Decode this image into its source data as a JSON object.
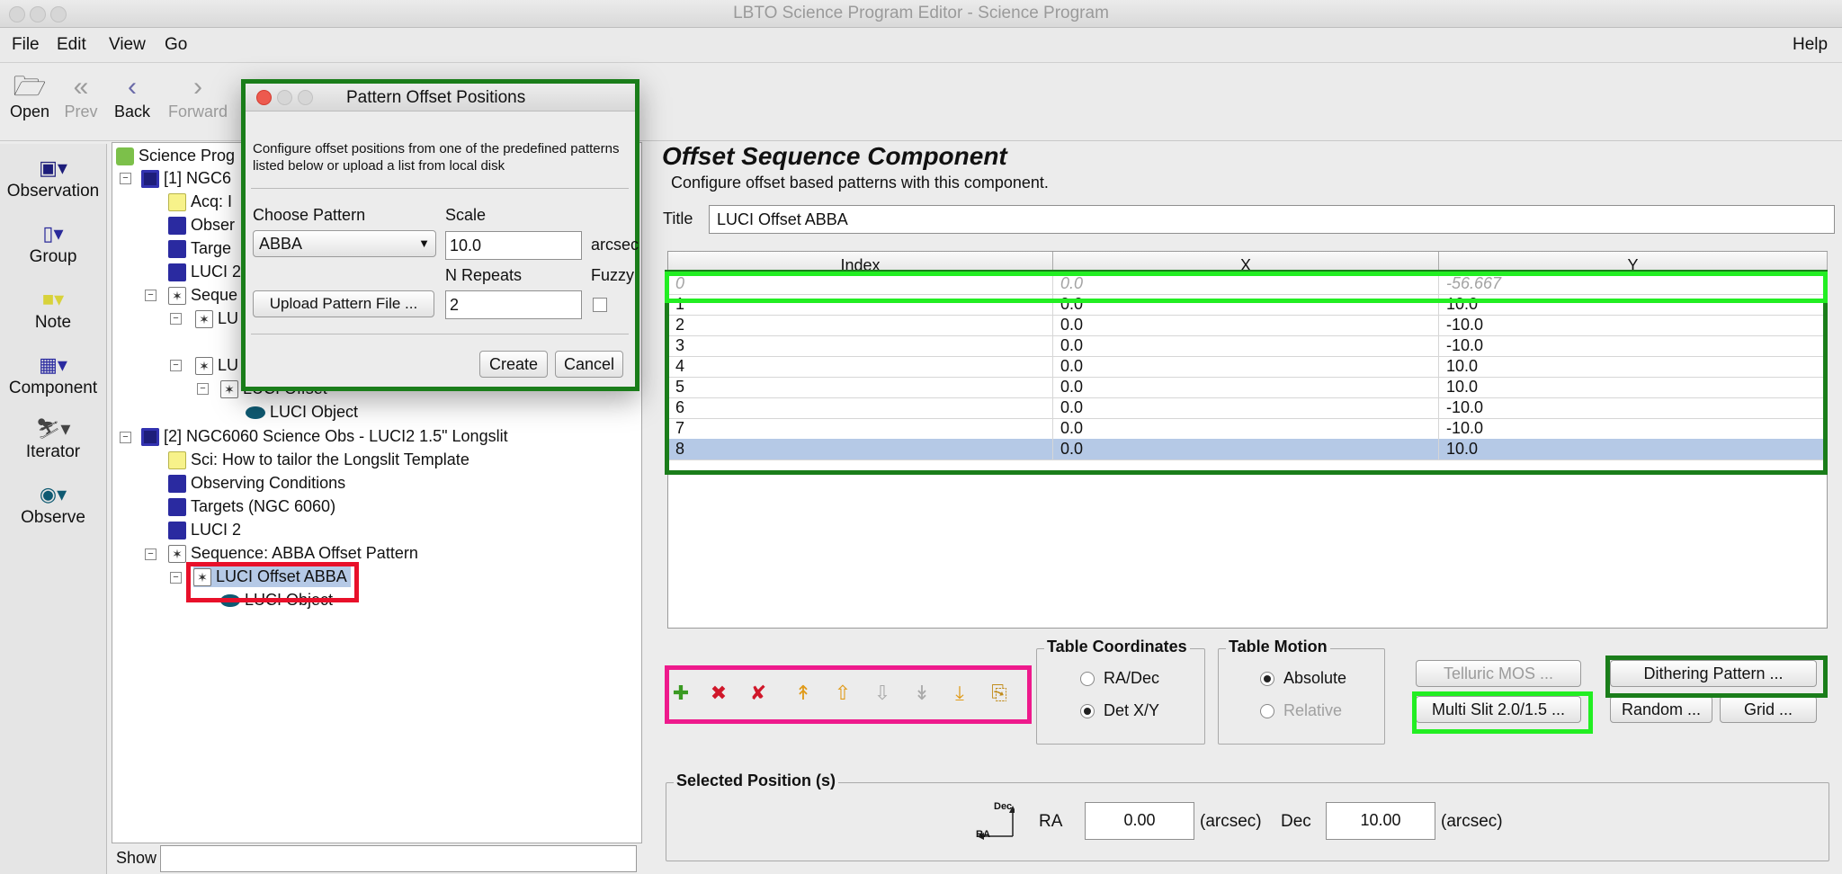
{
  "window": {
    "title": "LBTO Science Program Editor - Science Program"
  },
  "menubar": {
    "items": [
      "File",
      "Edit",
      "View",
      "Go"
    ],
    "help": "Help"
  },
  "toolbar": {
    "open": "Open",
    "prev": "Prev",
    "back": "Back",
    "forward": "Forward"
  },
  "palette": {
    "items": [
      "Observation",
      "Group",
      "Note",
      "Component",
      "Iterator",
      "Observe"
    ]
  },
  "tree": {
    "root": "Science Prog",
    "nodes": [
      "[1] NGC6",
      "Acq: I",
      "Obser",
      "Targe",
      "LUCI 2",
      "Seque",
      "LU",
      "LU",
      "LUCI Offset",
      "LUCI Object",
      "[2] NGC6060 Science Obs - LUCI2 1.5\" Longslit",
      "Sci: How to tailor the Longslit Template",
      "Observing Conditions",
      "Targets (NGC 6060)",
      "LUCI 2",
      "Sequence: ABBA Offset Pattern",
      "LUCI Offset ABBA",
      "LUCI Object"
    ],
    "show_label": "Show"
  },
  "component": {
    "heading": "Offset Sequence Component",
    "description": "Configure offset based patterns with this component.",
    "title_label": "Title",
    "title_value": "LUCI Offset ABBA"
  },
  "table": {
    "headers": [
      "Index",
      "X",
      "Y"
    ],
    "rows": [
      [
        "0",
        "0.0",
        "-56.667"
      ],
      [
        "1",
        "0.0",
        "10.0"
      ],
      [
        "2",
        "0.0",
        "-10.0"
      ],
      [
        "3",
        "0.0",
        "-10.0"
      ],
      [
        "4",
        "0.0",
        "10.0"
      ],
      [
        "5",
        "0.0",
        "10.0"
      ],
      [
        "6",
        "0.0",
        "-10.0"
      ],
      [
        "7",
        "0.0",
        "-10.0"
      ],
      [
        "8",
        "0.0",
        "10.0"
      ]
    ]
  },
  "coords": {
    "label": "Table Coordinates",
    "opt1": "RA/Dec",
    "opt2": "Det X/Y"
  },
  "motion": {
    "label": "Table Motion",
    "opt1": "Absolute",
    "opt2": "Relative"
  },
  "buttons": {
    "telluric": "Telluric MOS ...",
    "multislit": "Multi Slit 2.0/1.5 ...",
    "dithering": "Dithering Pattern ...",
    "random": "Random ...",
    "grid": "Grid ..."
  },
  "selected": {
    "label": "Selected Position (s)",
    "ra_label": "RA",
    "ra_value": "0.00",
    "ra_unit": "(arcsec)",
    "dec_label": "Dec",
    "dec_value": "10.00",
    "dec_unit": "(arcsec)",
    "axis_dec": "Dec",
    "axis_ra": "RA"
  },
  "dialog": {
    "title": "Pattern Offset Positions",
    "description": "Configure offset positions from one of the predefined patterns listed below or upload a list from local disk",
    "choose_label": "Choose Pattern",
    "pattern_value": "ABBA",
    "scale_label": "Scale",
    "scale_value": "10.0",
    "scale_unit": "arcsec",
    "upload_label": "Upload Pattern File ...",
    "repeats_label": "N Repeats",
    "repeats_value": "2",
    "fuzzy_label": "Fuzzy",
    "create": "Create",
    "cancel": "Cancel"
  },
  "colors": {
    "highlight_dark_green": "#1a7d1a",
    "highlight_bright_green": "#22ee22",
    "highlight_red": "#e8102a",
    "highlight_pink": "#ee1a8c",
    "selection": "#b5c9e6"
  }
}
